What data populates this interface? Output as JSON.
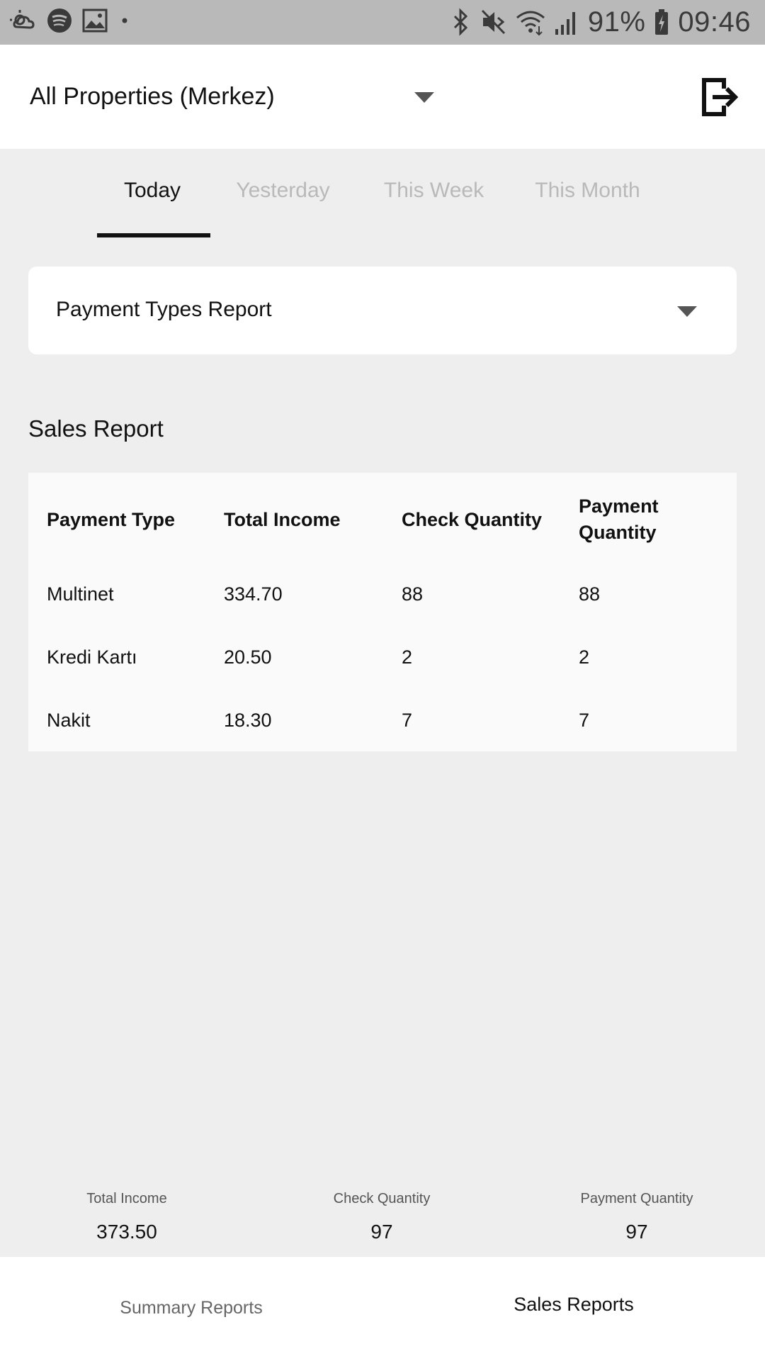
{
  "status_bar": {
    "battery": "91%",
    "time": "09:46"
  },
  "header": {
    "property_label": "All Properties (Merkez)"
  },
  "tabs": [
    {
      "label": "Today",
      "active": true
    },
    {
      "label": "Yesterday",
      "active": false
    },
    {
      "label": "This Week",
      "active": false
    },
    {
      "label": "This Month",
      "active": false
    }
  ],
  "report_select": {
    "label": "Payment Types Report"
  },
  "sales_report": {
    "title": "Sales Report",
    "columns": [
      "Payment Type",
      "Total Income",
      "Check Quantity",
      "Payment Quantity"
    ],
    "rows": [
      {
        "payment_type": "Multinet",
        "total_income": "334.70",
        "check_quantity": "88",
        "payment_quantity": "88"
      },
      {
        "payment_type": "Kredi Kartı",
        "total_income": "20.50",
        "check_quantity": "2",
        "payment_quantity": "2"
      },
      {
        "payment_type": "Nakit",
        "total_income": "18.30",
        "check_quantity": "7",
        "payment_quantity": "7"
      }
    ]
  },
  "totals": {
    "total_income_label": "Total Income",
    "total_income_value": "373.50",
    "check_quantity_label": "Check Quantity",
    "check_quantity_value": "97",
    "payment_quantity_label": "Payment Quantity",
    "payment_quantity_value": "97"
  },
  "bottom_nav": {
    "items": [
      {
        "label": "Summary Reports",
        "active": false
      },
      {
        "label": "Sales Reports",
        "active": true
      }
    ]
  },
  "icons": {
    "status_left": [
      "weather-icon",
      "spotify-icon",
      "gallery-icon",
      "notification-dot-icon"
    ],
    "status_right": [
      "bluetooth-icon",
      "mute-icon",
      "wifi-icon",
      "signal-icon",
      "battery-charging-icon"
    ],
    "header": [
      "dropdown-caret-icon",
      "logout-icon"
    ]
  }
}
